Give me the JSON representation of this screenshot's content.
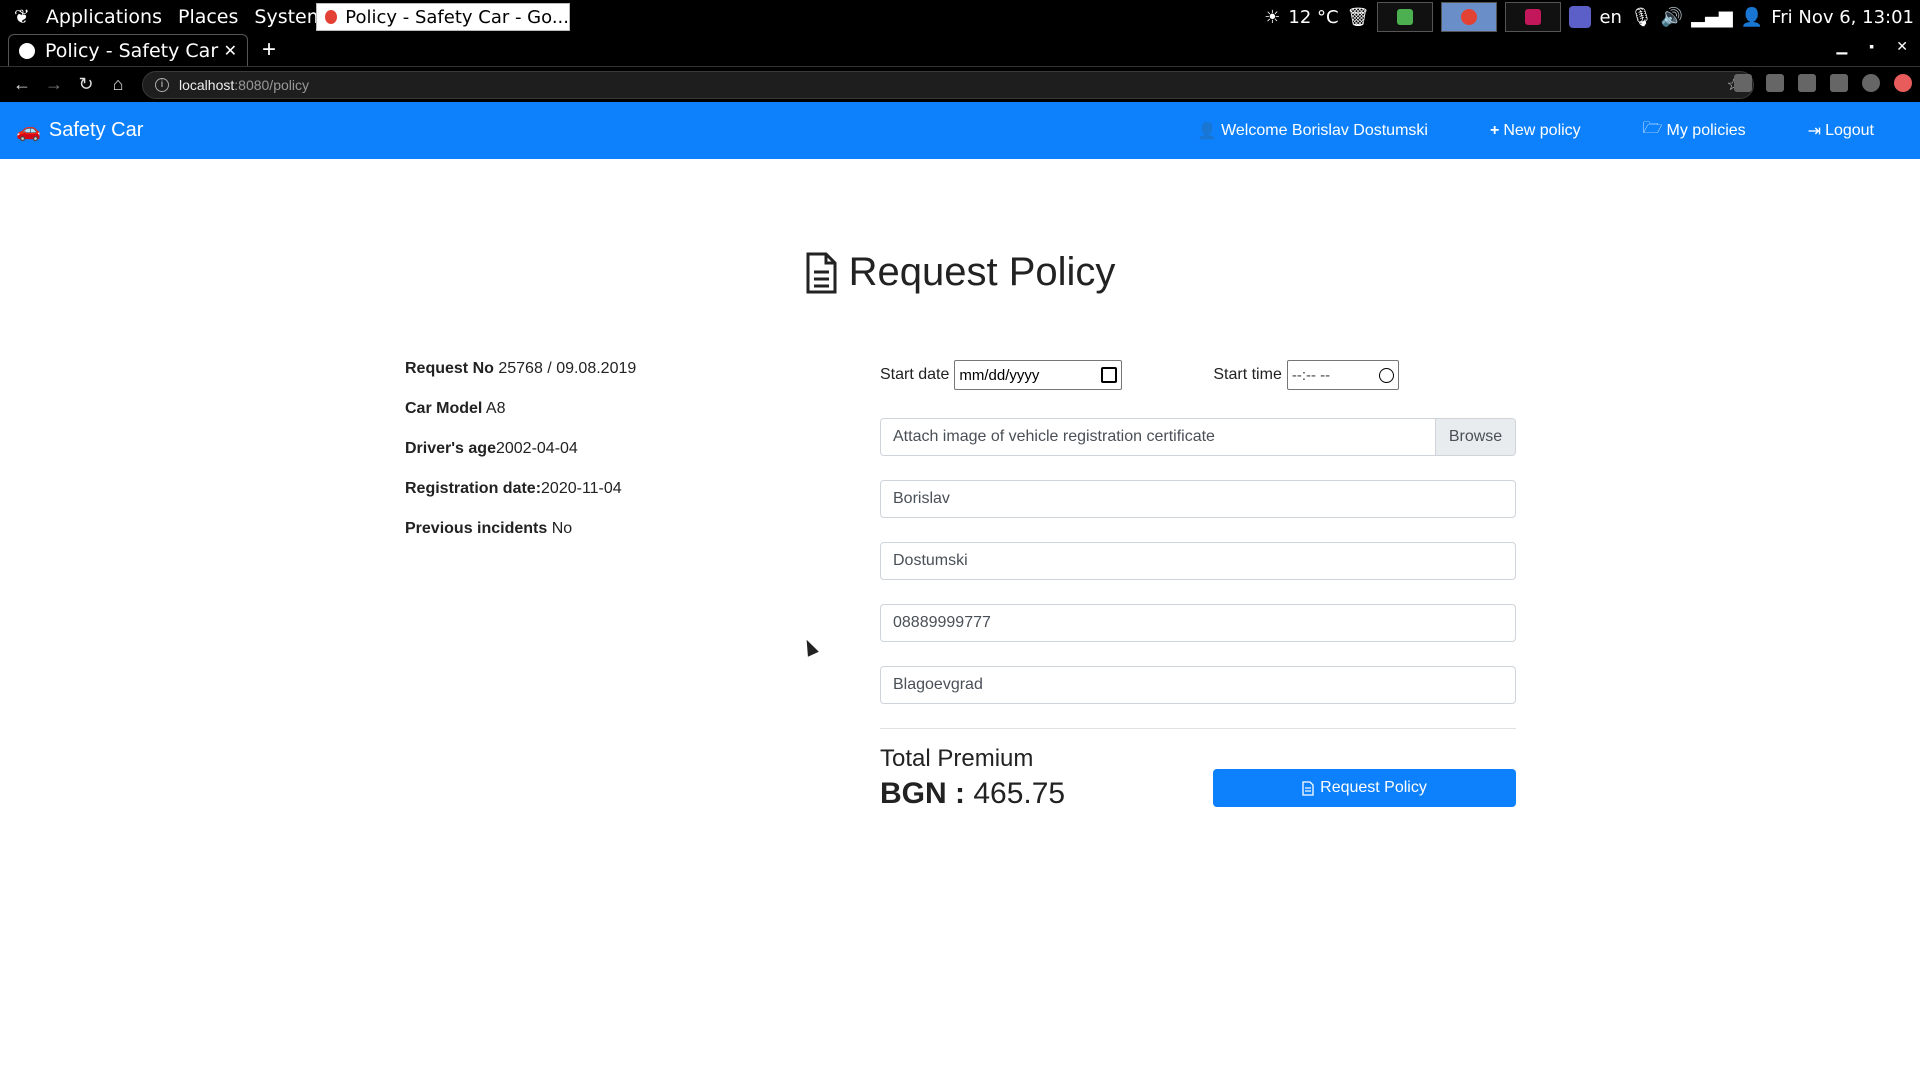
{
  "os_panel": {
    "menu": [
      "Applications",
      "Places",
      "System"
    ],
    "task_title": "Policy - Safety Car - Go...",
    "weather": "12 °C",
    "lang": "en",
    "clock": "Fri Nov  6, 13:01"
  },
  "browser": {
    "tab_title": "Policy - Safety Car",
    "url_host": "localhost",
    "url_path": ":8080/policy"
  },
  "navbar": {
    "brand": "Safety Car",
    "links": {
      "welcome": "Welcome Borislav Dostumski",
      "new_policy": "New policy",
      "my_policies": "My policies",
      "logout": "Logout"
    }
  },
  "page": {
    "title": "Request Policy"
  },
  "summary": {
    "request_no_label": "Request No",
    "request_no_value": "25768 / 09.08.2019",
    "car_model_label": "Car Model",
    "car_model_value": "A8",
    "drivers_age_label": "Driver's age",
    "drivers_age_value": "2002-04-04",
    "registration_label": "Registration date:",
    "registration_value": "2020-11-04",
    "incidents_label": "Previous incidents",
    "incidents_value": "No"
  },
  "form": {
    "start_date_label": "Start date",
    "start_date_value": "mm/dd/yyyy",
    "start_time_label": "Start time",
    "start_time_value": "--:-- --",
    "file_label": "Attach image of vehicle registration certificate",
    "browse_label": "Browse",
    "first_name": "Borislav",
    "last_name": "Dostumski",
    "phone": "08889999777",
    "city": "Blagoevgrad",
    "total_premium_label": "Total Premium",
    "currency": "BGN :",
    "amount": "465.75",
    "submit_label": "Request Policy"
  },
  "colors": {
    "primary": "#0d80fc"
  }
}
